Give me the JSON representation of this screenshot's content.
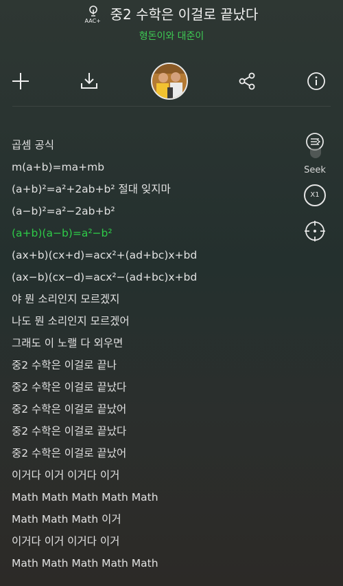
{
  "header": {
    "badge_label": "AAC+",
    "song_title": "중2 수학은 이걸로 끝났다",
    "artist": "형돈이와 대준이"
  },
  "toolbar": {
    "add_icon": "plus-icon",
    "download_icon": "download-icon",
    "avatar": "artist-photo",
    "share_icon": "share-icon",
    "info_icon": "info-icon"
  },
  "side_controls": {
    "seek_label": "Seek",
    "speed_label": "X1",
    "sync_icon": "crosshair-icon"
  },
  "colors": {
    "accent": "#2ecc48",
    "text": "#e2e2e2"
  },
  "lyrics": [
    "곱셈 공식",
    "m(a+b)=ma+mb",
    "(a+b)²=a²+2ab+b²  절대 잊지마",
    "(a−b)²=a²−2ab+b²",
    "(a+b)(a−b)=a²−b²",
    "(ax+b)(cx+d)=acx²+(ad+bc)x+bd",
    "(ax−b)(cx−d)=acx²−(ad+bc)x+bd",
    "야 뭔 소리인지 모르겠지",
    "나도 뭔 소리인지 모르겠어",
    "그래도 이 노랠 다 외우면",
    "중2 수학은 이걸로 끝나",
    "중2 수학은 이걸로 끝났다",
    "중2 수학은 이걸로 끝났어",
    "중2 수학은 이걸로 끝났다",
    "중2 수학은 이걸로 끝났어",
    "이거다 이거 이거다 이거",
    "Math Math Math Math Math",
    "Math Math Math 이거",
    "이거다 이거 이거다 이거",
    "Math Math Math Math Math"
  ],
  "active_line_index": 4
}
